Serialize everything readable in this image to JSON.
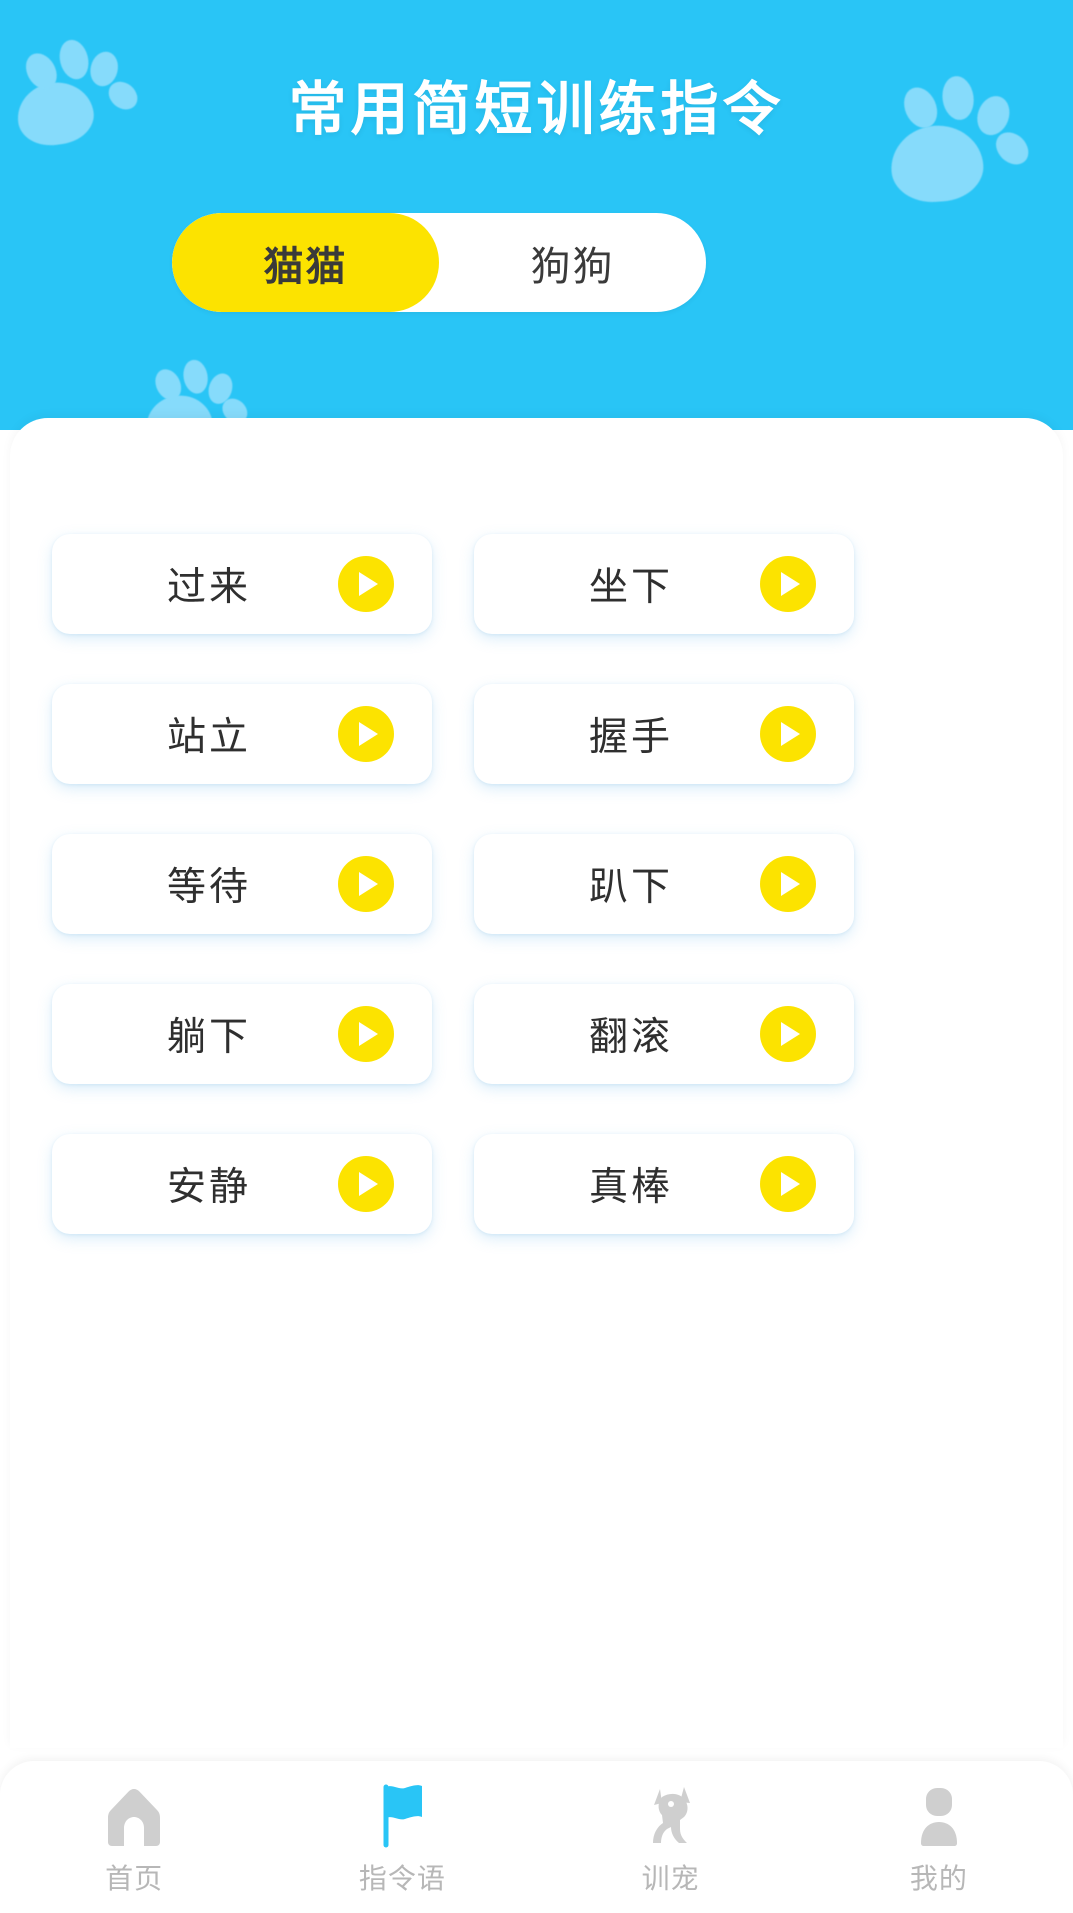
{
  "header": {
    "title": "常用简短训练指令",
    "background_color": "#29C5F6",
    "title_color": "#FFFFFF",
    "paw_color": "#86DBFB"
  },
  "segment": {
    "active_color": "#FCE300",
    "track_color": "#FFFFFF",
    "selected": "猫猫",
    "options": [
      {
        "label": "猫猫",
        "active": true
      },
      {
        "label": "狗狗",
        "active": false
      }
    ]
  },
  "commands": {
    "play_icon": "play-icon",
    "accent_color": "#FCE300",
    "items": [
      {
        "label": "过来"
      },
      {
        "label": "坐下"
      },
      {
        "label": "站立"
      },
      {
        "label": "握手"
      },
      {
        "label": "等待"
      },
      {
        "label": "趴下"
      },
      {
        "label": "躺下"
      },
      {
        "label": "翻滚"
      },
      {
        "label": "安静"
      },
      {
        "label": "真棒"
      }
    ]
  },
  "bottom_nav": {
    "active_color": "#29C5F6",
    "inactive_color": "#CFCFCF",
    "label_color": "#B7B7B7",
    "items": [
      {
        "label": "首页",
        "icon": "home-icon",
        "active": false
      },
      {
        "label": "指令语",
        "icon": "flag-icon",
        "active": true
      },
      {
        "label": "训宠",
        "icon": "dog-icon",
        "active": false
      },
      {
        "label": "我的",
        "icon": "person-icon",
        "active": false
      }
    ]
  }
}
